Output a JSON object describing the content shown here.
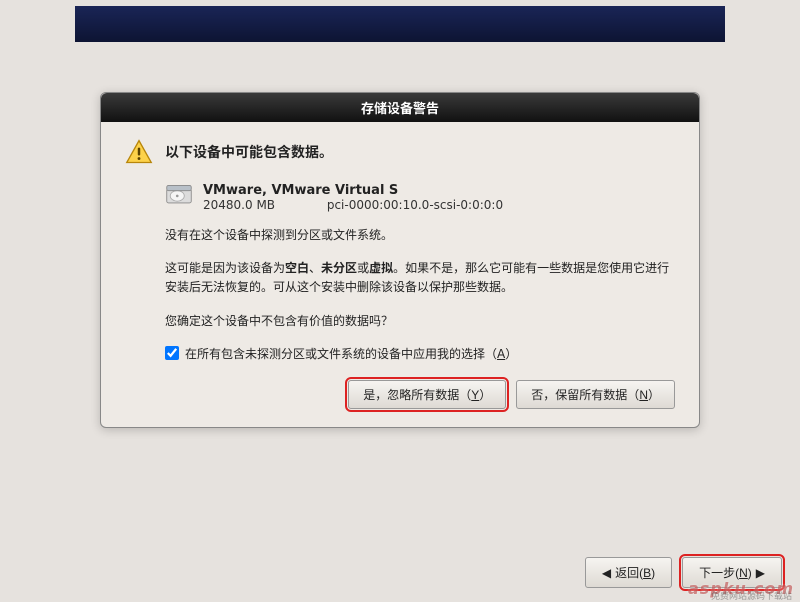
{
  "dialog": {
    "title": "存储设备警告",
    "heading": "以下设备中可能包含数据。",
    "device": {
      "name": "VMware, VMware Virtual S",
      "size": "20480.0 MB",
      "path": "pci-0000:00:10.0-scsi-0:0:0:0"
    },
    "para1": "没有在这个设备中探测到分区或文件系统。",
    "para2_pre": "这可能是因为该设备为",
    "para2_b1": "空白",
    "para2_sep1": "、",
    "para2_b2": "未分区",
    "para2_sep2": "或",
    "para2_b3": "虚拟",
    "para2_post": "。如果不是，那么它可能有一些数据是您使用它进行安装后无法恢复的。可从这个安装中删除该设备以保护那些数据。",
    "para3": "您确定这个设备中不包含有价值的数据吗？",
    "checkbox_label_pre": "在所有包含未探测分区或文件系统的设备中应用我的选择（",
    "checkbox_key": "A",
    "checkbox_label_post": "）",
    "btn_yes_pre": "是，忽略所有数据（",
    "btn_yes_key": "Y",
    "btn_yes_post": "）",
    "btn_no_pre": "否，保留所有数据（",
    "btn_no_key": "N",
    "btn_no_post": "）"
  },
  "footer": {
    "back_pre": "返回(",
    "back_key": "B",
    "back_post": ")",
    "next_pre": "下一步(",
    "next_key": "N",
    "next_post": ")"
  },
  "watermark": {
    "main": "aspku.com",
    "sub": "免费网站源码下载站"
  }
}
